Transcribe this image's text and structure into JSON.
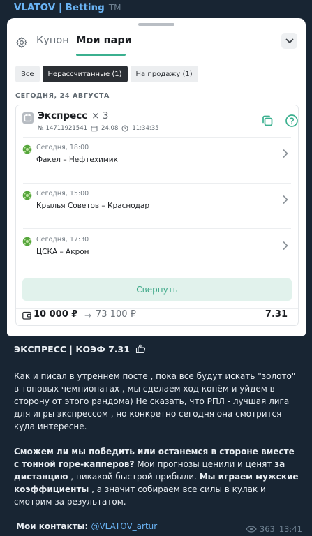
{
  "channel": {
    "name": "VLATOV | Betting",
    "tm": "TM"
  },
  "app": {
    "tabs": [
      {
        "label": "Купон"
      },
      {
        "label": "Мои пари"
      }
    ],
    "filters": [
      {
        "label": "Все"
      },
      {
        "label": "Нерассчитанные (1)"
      },
      {
        "label": "На продажу (1)"
      }
    ],
    "date_header": "СЕГОДНЯ, 24 АВГУСТА",
    "bet": {
      "title": "Экспресс",
      "multiplier": "× 3",
      "number": "№ 14711921541",
      "date": "24.08",
      "time": "11:34:35",
      "events": [
        {
          "time": "Сегодня, 18:00",
          "name": "Факел – Нефтехимик"
        },
        {
          "time": "Сегодня, 15:00",
          "name": "Крылья Советов – Краснодар"
        },
        {
          "time": "Сегодня, 17:30",
          "name": "ЦСКА – Акрон"
        }
      ],
      "collapse_label": "Свернуть",
      "stake": "10 000 ₽",
      "arrow": "→",
      "payout": "73 100 ₽",
      "coefficient": "7.31"
    },
    "colors": {
      "accent": "#3bb08f",
      "accent_light": "#e1f2ec"
    }
  },
  "post": {
    "heading": "ЭКСПРЕСС | КОЭФ 7.31",
    "p1": "Как и писал в утреннем посте , пока все будут искать \"золото\" в топовых чемпионатах , мы сделаем ход конём и уйдем в сторону от этого рандома) Не сказать, что РПЛ - лучшая лига для игры экспрессом , но конкретно сегодня она смотрится куда интересне.",
    "p2_bold1": "Сможем ли мы победить или останемся в стороне вместе с тонной горе-капперов?",
    "p2_text1": " Мои прогнозы ценили и ценят ",
    "p2_bold2": "за дистанцию",
    "p2_text2": " , никакой быстрой прибыли. ",
    "p2_bold3": "Мы играем мужские коэффициенты",
    "p2_text3": " , а значит собираем все силы в кулак и смотрим за результатом.",
    "contacts_label": "Мои контакты: ",
    "contacts_link": "@VLATOV_artur",
    "views": "363",
    "time": "13:41"
  }
}
